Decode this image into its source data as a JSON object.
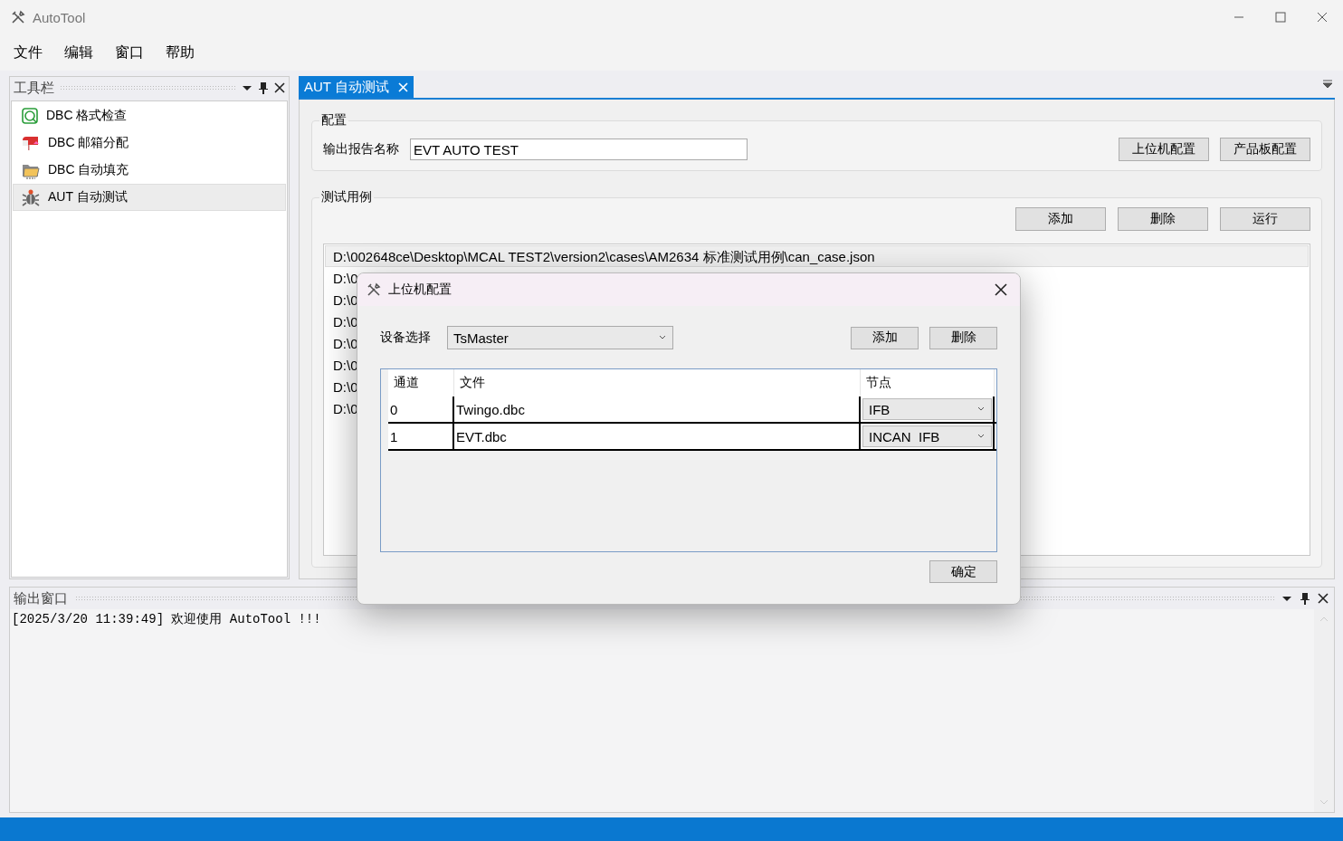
{
  "window": {
    "title": "AutoTool"
  },
  "menu": [
    {
      "label": "文件"
    },
    {
      "label": "编辑"
    },
    {
      "label": "窗口"
    },
    {
      "label": "帮助"
    }
  ],
  "toolbox": {
    "title": "工具栏",
    "items": [
      {
        "label": "DBC 格式检查",
        "kind": "check",
        "selected": false
      },
      {
        "label": "DBC 邮箱分配",
        "kind": "mailbox",
        "selected": false
      },
      {
        "label": "DBC 自动填充",
        "kind": "folder",
        "selected": false
      },
      {
        "label": "AUT 自动测试",
        "kind": "bug",
        "selected": true
      }
    ]
  },
  "document": {
    "tabs": [
      {
        "label": "AUT 自动测试",
        "selected": true
      }
    ],
    "config": {
      "title": "配置",
      "report_label": "输出报告名称",
      "report_value": "EVT AUTO TEST",
      "buttons": [
        "上位机配置",
        "产品板配置"
      ]
    },
    "cases": {
      "title": "测试用例",
      "buttons": [
        "添加",
        "删除",
        "运行"
      ],
      "rows": [
        {
          "path": "D:\\002648ce\\Desktop\\MCAL TEST2\\version2\\cases\\AM2634 标准测试用例\\can_case.json",
          "selected": true
        },
        {
          "path": "D:\\0",
          "selected": false
        },
        {
          "path": "D:\\0",
          "selected": false
        },
        {
          "path": "D:\\0",
          "selected": false
        },
        {
          "path": "D:\\0",
          "selected": false
        },
        {
          "path": "D:\\0",
          "selected": false
        },
        {
          "path": "D:\\0",
          "selected": false
        },
        {
          "path": "D:\\0",
          "selected": false
        }
      ]
    }
  },
  "output": {
    "title": "输出窗口",
    "lines": [
      "[2025/3/20 11:39:49] 欢迎使用 AutoTool !!!"
    ]
  },
  "dialog": {
    "title": "上位机配置",
    "device_label": "设备选择",
    "device_value": "TsMaster",
    "buttons": [
      "添加",
      "删除"
    ],
    "columns": [
      "通道",
      "文件",
      "节点"
    ],
    "rows": [
      {
        "channel": "0",
        "file": "Twingo.dbc",
        "node": "IFB"
      },
      {
        "channel": "1",
        "file": "EVT.dbc",
        "node": "INCAN  IFB"
      }
    ],
    "ok": "确定"
  }
}
